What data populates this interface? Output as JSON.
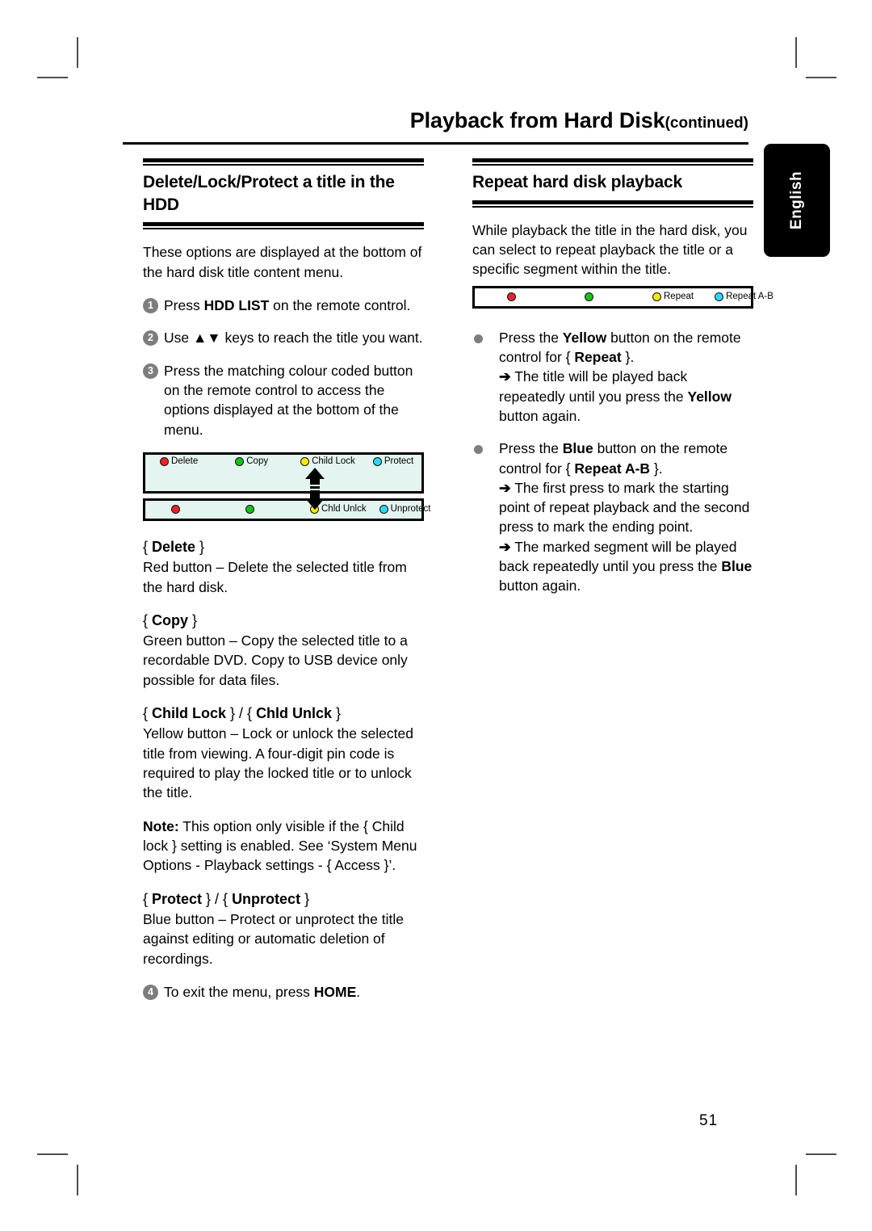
{
  "page": {
    "number": "51",
    "language_tab": "English"
  },
  "header": {
    "title": "Playback from Hard Disk",
    "continued": "(continued)"
  },
  "left_column": {
    "heading": "Delete/Lock/Protect a title in the HDD",
    "intro": "These options are displayed at the bottom of the hard disk title content menu.",
    "steps": [
      {
        "num": "1",
        "pre": "Press ",
        "key": "HDD LIST",
        "post": " on the remote control."
      },
      {
        "num": "2",
        "pre": "Use ",
        "key": "▲▼",
        "post": " keys to reach the title you want."
      },
      {
        "num": "3",
        "pre": "Press the matching colour coded button on the remote control to access the options displayed at the bottom of the menu.",
        "key": "",
        "post": ""
      },
      {
        "num": "4",
        "pre": "To exit the menu, press ",
        "key": "HOME",
        "post": "."
      }
    ],
    "osd_bar_top": {
      "name": "hdd-title-options-bar",
      "cells": [
        {
          "color": "red",
          "label": "Delete"
        },
        {
          "color": "green",
          "label": "Copy"
        },
        {
          "color": "yellow",
          "label": "Child Lock"
        },
        {
          "color": "cyan",
          "label": "Protect"
        }
      ]
    },
    "osd_bar_bottom": {
      "name": "hdd-title-options-bar-alt",
      "cells": [
        {
          "color": "red",
          "label": ""
        },
        {
          "color": "green",
          "label": ""
        },
        {
          "color": "yellow",
          "label": "Chld Unlck"
        },
        {
          "color": "cyan",
          "label": "Unprotect"
        }
      ]
    },
    "options": [
      {
        "title_open": "{ ",
        "title_bold": "Delete",
        "title_close": " }",
        "body": "Red button – Delete the selected title from the hard disk."
      },
      {
        "title_open": "{ ",
        "title_bold": "Copy",
        "title_close": " }",
        "body": "Green button – Copy the selected title to a recordable DVD.  Copy to USB device only possible for data files."
      },
      {
        "title_open": "{ ",
        "title_bold": "Child Lock",
        "title_mid": " } / { ",
        "title_bold2": "Chld Unlck",
        "title_close": " }",
        "body": "Yellow button – Lock or unlock the selected title from viewing.  A four-digit pin code is required to play the locked title or to unlock the title.",
        "note_label": "Note:",
        "note_body": " This option only visible if the { Child lock } setting is enabled.  See ‘System Menu Options - Playback settings - { Access }’."
      },
      {
        "title_open": "{ ",
        "title_bold": "Protect",
        "title_mid": " } / { ",
        "title_bold2": "Unprotect",
        "title_close": " }",
        "body": "Blue button – Protect or unprotect the title against editing or automatic deletion of recordings."
      }
    ]
  },
  "right_column": {
    "heading": "Repeat hard disk playback",
    "intro": "While playback the title in the hard disk, you can select to repeat playback the title or a specific segment within the title.",
    "osd_bar_repeat": {
      "name": "repeat-options-bar",
      "cells": [
        {
          "color": "red",
          "label": ""
        },
        {
          "color": "green",
          "label": ""
        },
        {
          "color": "yellow",
          "label": "Repeat"
        },
        {
          "color": "cyan",
          "label": "Repeat A-B"
        }
      ]
    },
    "bullets": [
      {
        "pre": "Press the ",
        "key1": "Yellow",
        "mid": " button on the remote control for { ",
        "key2": "Repeat",
        "post": " }.",
        "results": [
          {
            "arrow": "➔",
            "pre": " The title will be played back repeatedly until you press the ",
            "key": "Yellow",
            "post": " button again."
          }
        ]
      },
      {
        "pre": "Press the ",
        "key1": "Blue",
        "mid": " button on the remote control for { ",
        "key2": "Repeat A-B",
        "post": " }.",
        "results": [
          {
            "arrow": "➔",
            "pre": " The first press to mark the starting point of repeat playback and the second press to mark the ending point.",
            "key": "",
            "post": ""
          },
          {
            "arrow": "➔",
            "pre": " The marked segment will be played back repeatedly until you press the ",
            "key": "Blue",
            "post": " button again."
          }
        ]
      }
    ]
  },
  "colors": {
    "red": "#e8232a",
    "green": "#16c11a",
    "yellow": "#f5e611",
    "cyan": "#2fd8f0",
    "osd_background": "#e4f4f1",
    "marker_gray": "#7d7d7d"
  }
}
